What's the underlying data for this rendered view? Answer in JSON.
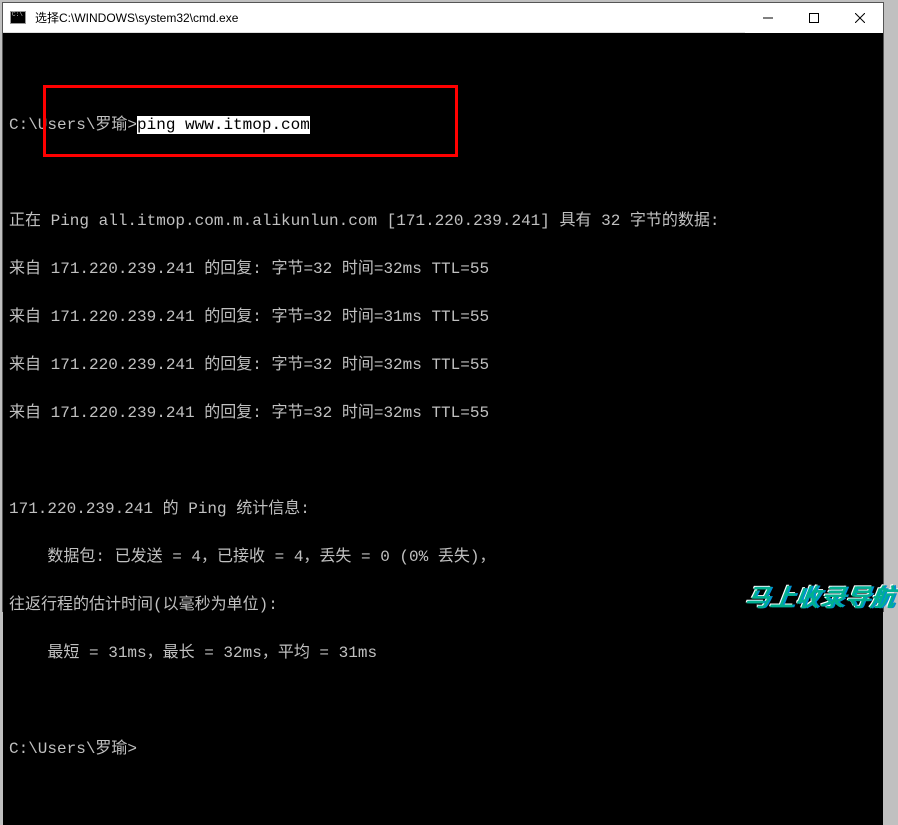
{
  "window": {
    "title": "选择C:\\WINDOWS\\system32\\cmd.exe"
  },
  "terminal": {
    "prompt1_prefix": "C:\\Users\\罗瑜>",
    "prompt1_cmd": "ping www.itmop.com",
    "pinging": "正在 Ping all.itmop.com.m.alikunlun.com [171.220.239.241] 具有 32 字节的数据:",
    "replies": [
      {
        "prefix": "来自 ",
        "body": "171.220.239.241 的回复: 字节=32 时间=32ms TTL=55"
      },
      {
        "prefix": "来自 ",
        "body": "171.220.239.241 的回复: 字节=32 时间=31ms TTL=55"
      },
      {
        "prefix": "来自 ",
        "body": "171.220.239.241 的回复: 字节=32 时间=32ms TTL=55"
      },
      {
        "prefix": "来自 ",
        "body": "171.220.239.241 的回复: 字节=32 时间=32ms TTL=55"
      }
    ],
    "stats_header": "171.220.239.241 的 Ping 统计信息:",
    "stats_packets": "    数据包: 已发送 = 4，已接收 = 4，丢失 = 0 (0% 丢失)，",
    "stats_rtt_header": "往返行程的估计时间(以毫秒为单位):",
    "stats_rtt": "    最短 = 31ms，最长 = 32ms，平均 = 31ms",
    "prompt2": "C:\\Users\\罗瑜>"
  },
  "watermark": "马上收录导航"
}
